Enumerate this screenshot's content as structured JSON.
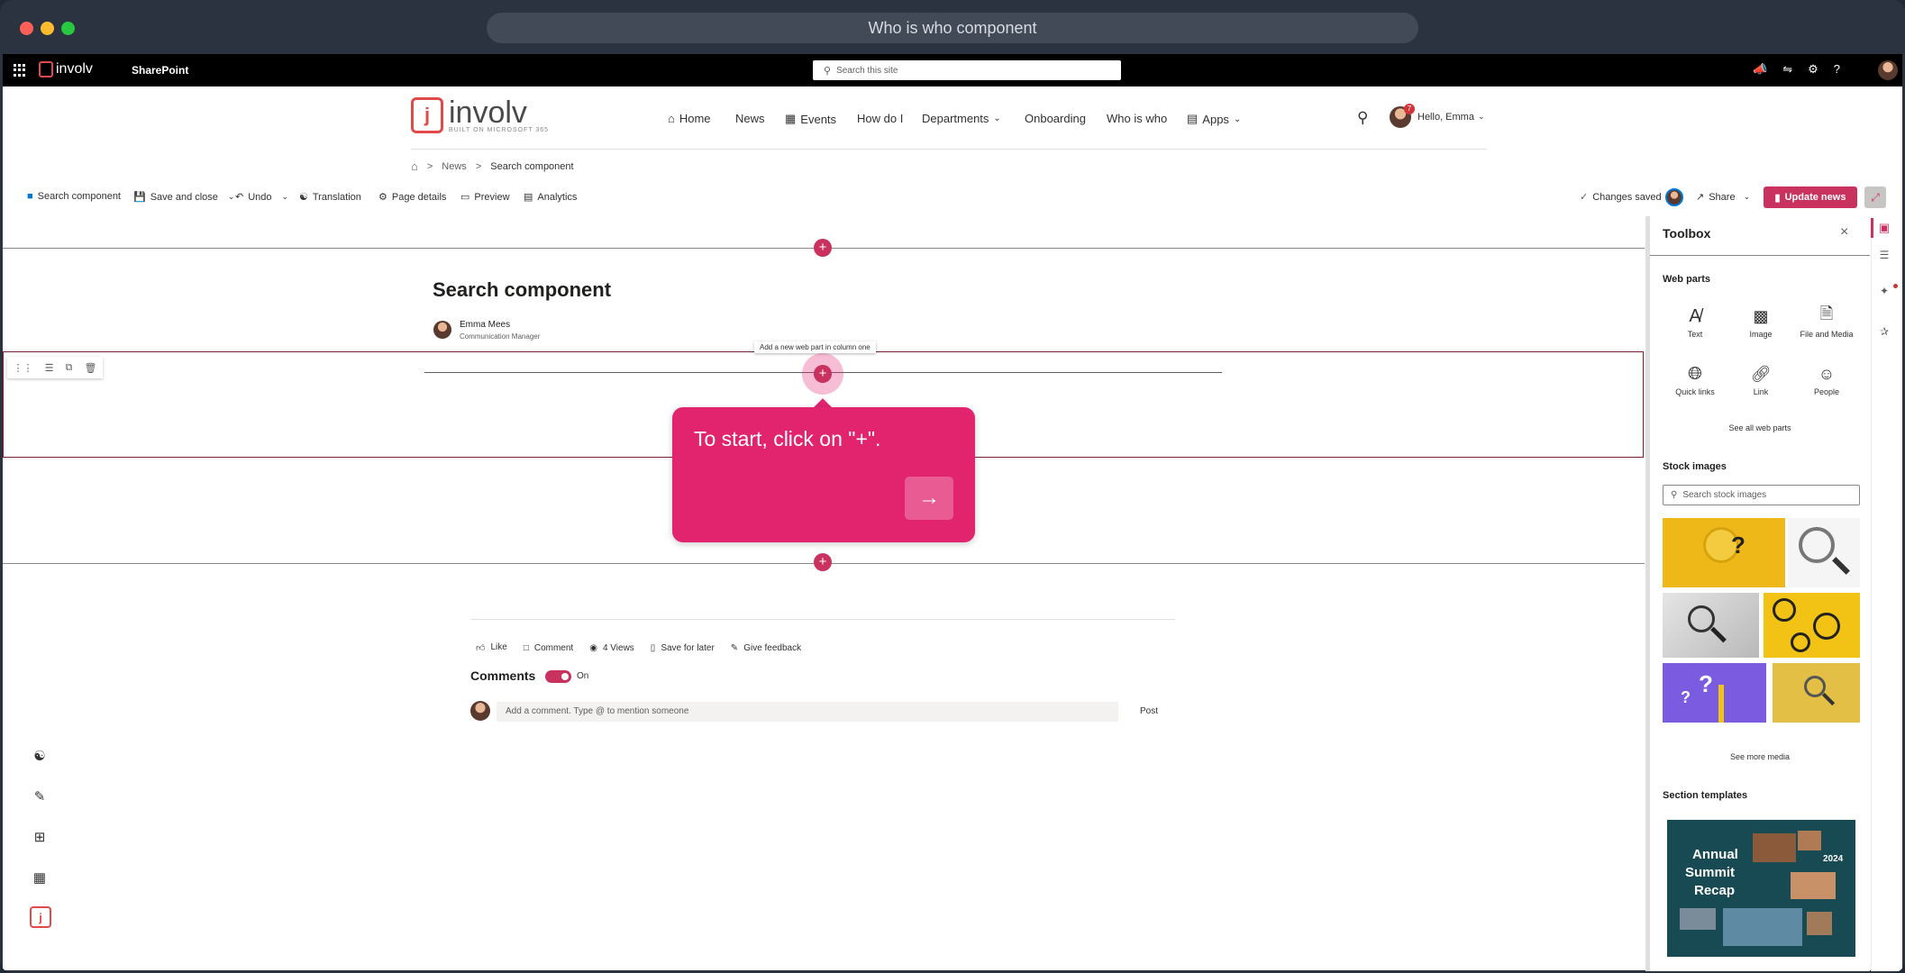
{
  "window": {
    "title": "Who is who component"
  },
  "suitebar": {
    "app_name": "SharePoint",
    "brand": "involv",
    "search_placeholder": "Search this site"
  },
  "site": {
    "logo_text": "involv",
    "logo_tagline": "BUILT ON MICROSOFT 365",
    "nav": [
      {
        "label": "Home"
      },
      {
        "label": "News"
      },
      {
        "label": "Events"
      },
      {
        "label": "How do I"
      },
      {
        "label": "Departments"
      },
      {
        "label": "Onboarding"
      },
      {
        "label": "Who is who"
      },
      {
        "label": "Apps"
      }
    ],
    "greeting": "Hello, Emma",
    "notif_count": "7"
  },
  "breadcrumb": {
    "items": [
      ">",
      "News",
      ">",
      "Search component"
    ]
  },
  "toolbar": {
    "search_component": "Search component",
    "save_close": "Save and close",
    "undo": "Undo",
    "translation": "Translation",
    "page_details": "Page details",
    "preview": "Preview",
    "analytics": "Analytics",
    "changes_saved": "Changes saved",
    "share": "Share",
    "update_news": "Update news"
  },
  "page": {
    "title": "Search component",
    "author": "Emma Mees",
    "author_role": "Communication Manager",
    "add_tooltip": "Add a new web part in column one"
  },
  "callout": {
    "text": "To start, click on \"+\"."
  },
  "footer": {
    "like": "Like",
    "comment": "Comment",
    "views": "4 Views",
    "save_later": "Save for later",
    "feedback": "Give feedback",
    "comments_heading": "Comments",
    "comments_toggle": "On",
    "comment_placeholder": "Add a comment. Type @ to mention someone",
    "post": "Post"
  },
  "toolbox": {
    "title": "Toolbox",
    "web_parts_heading": "Web parts",
    "web_parts": [
      {
        "label": "Text",
        "icon": "text-icon"
      },
      {
        "label": "Image",
        "icon": "image-icon"
      },
      {
        "label": "File and Media",
        "icon": "file-icon"
      },
      {
        "label": "Quick links",
        "icon": "globe-icon"
      },
      {
        "label": "Link",
        "icon": "link-icon"
      },
      {
        "label": "People",
        "icon": "person-icon"
      }
    ],
    "see_all": "See all web parts",
    "stock_heading": "Stock images",
    "stock_placeholder": "Search stock images",
    "see_more": "See more media",
    "templates_heading": "Section templates",
    "template": {
      "line1": "Annual",
      "line2": "Summit",
      "line3": "Recap",
      "year": "2024"
    }
  },
  "colors": {
    "accent": "#c9325f",
    "callout": "#e2246f",
    "dark": "#2b3240"
  }
}
